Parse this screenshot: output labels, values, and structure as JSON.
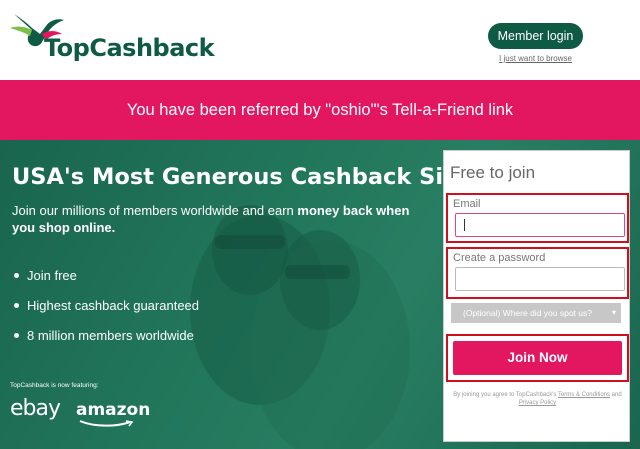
{
  "header": {
    "logo_text": "TopCashback",
    "member_login_label": "Member login",
    "browse_link": "I just want to browse"
  },
  "referral": {
    "text": "You have been referred by \"oshio\"'s Tell-a-Friend link"
  },
  "hero": {
    "title": "USA's Most Generous Cashback Site",
    "subtitle_plain": "Join our millions of members worldwide and earn ",
    "subtitle_bold": "money back when you shop online.",
    "bullets": [
      "Join free",
      "Highest cashback guaranteed",
      "8 million members worldwide"
    ],
    "featuring_label": "TopCashback is now featuring:",
    "partners": [
      "ebay",
      "amazon"
    ]
  },
  "signup": {
    "title": "Free to join",
    "email_label": "Email",
    "email_value": "",
    "password_label": "Create a password",
    "password_value": "",
    "select_value": "(Optional) Where did you spot us?",
    "join_button": "Join Now",
    "terms_prefix": "By joining you agree to TopCashback's ",
    "terms_link": "Terms & Conditions",
    "terms_and": " and ",
    "privacy_link": "Privacy Policy"
  },
  "colors": {
    "brand_green": "#0e5a45",
    "brand_pink": "#e3175f",
    "highlight_red": "#cc1020"
  }
}
